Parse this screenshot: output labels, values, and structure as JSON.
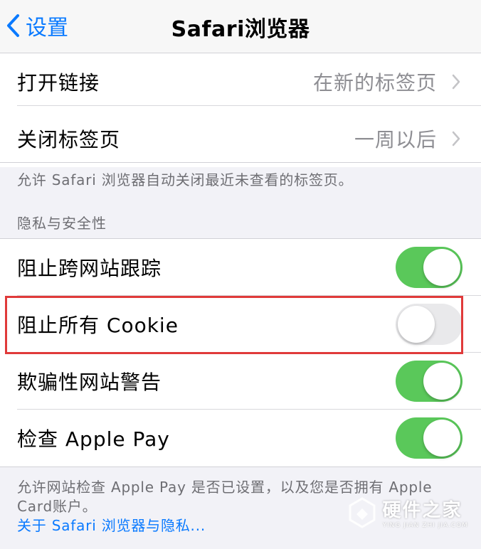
{
  "nav": {
    "back_label": "设置",
    "title": "Safari浏览器"
  },
  "tabs_group": {
    "rows": [
      {
        "label": "打开链接",
        "value": "在新的标签页"
      },
      {
        "label": "关闭标签页",
        "value": "一周以后"
      }
    ],
    "footer": "允许 Safari 浏览器自动关闭最近未查看的标签页。"
  },
  "privacy_group": {
    "header": "隐私与安全性",
    "rows": [
      {
        "label": "阻止跨网站跟踪",
        "on": true
      },
      {
        "label": "阻止所有 Cookie",
        "on": false
      },
      {
        "label": "欺骗性网站警告",
        "on": true
      },
      {
        "label": "检查 Apple Pay",
        "on": true
      }
    ],
    "footer": "允许网站检查 Apple Pay 是否已设置，以及您是否拥有 Apple Card账户。",
    "footer_link": "关于 Safari 浏览器与隐私..."
  },
  "watermark": {
    "name": "硬件之家",
    "pinyin": "YING JIAN ZHI JIA.COM"
  },
  "colors": {
    "accent": "#0a7aff",
    "toggle_on": "#5ac85a",
    "highlight": "#e03a3a"
  }
}
